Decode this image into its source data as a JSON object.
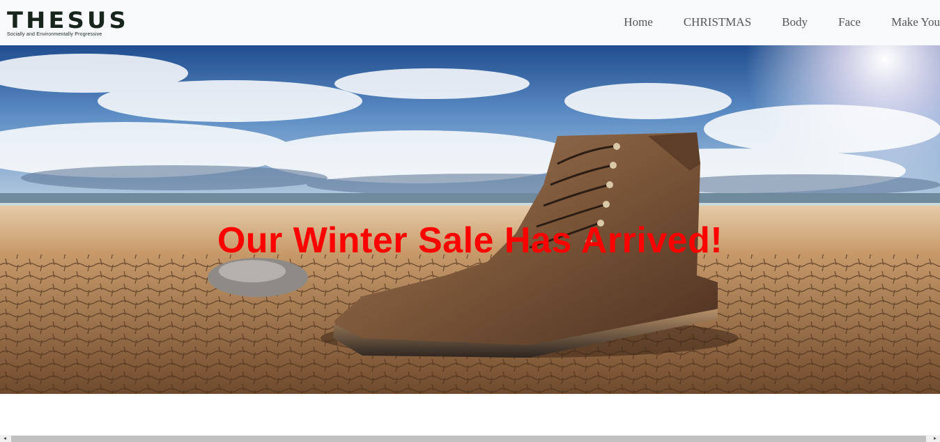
{
  "brand": {
    "name": "THESUS",
    "tagline": "Socially and Environmentally Progressive"
  },
  "nav": {
    "items": [
      "Home",
      "CHRISTMAS",
      "Body",
      "Face",
      "Make You"
    ]
  },
  "hero": {
    "title": "Our Winter Sale Has Arrived!"
  },
  "colors": {
    "header_bg": "#f8f9fa",
    "title": "#ff0000",
    "nav_text": "#555555",
    "logo": "#18251c"
  },
  "icons": {
    "scroll_left": "scroll-left-arrow-icon",
    "scroll_right": "scroll-right-arrow-icon"
  }
}
